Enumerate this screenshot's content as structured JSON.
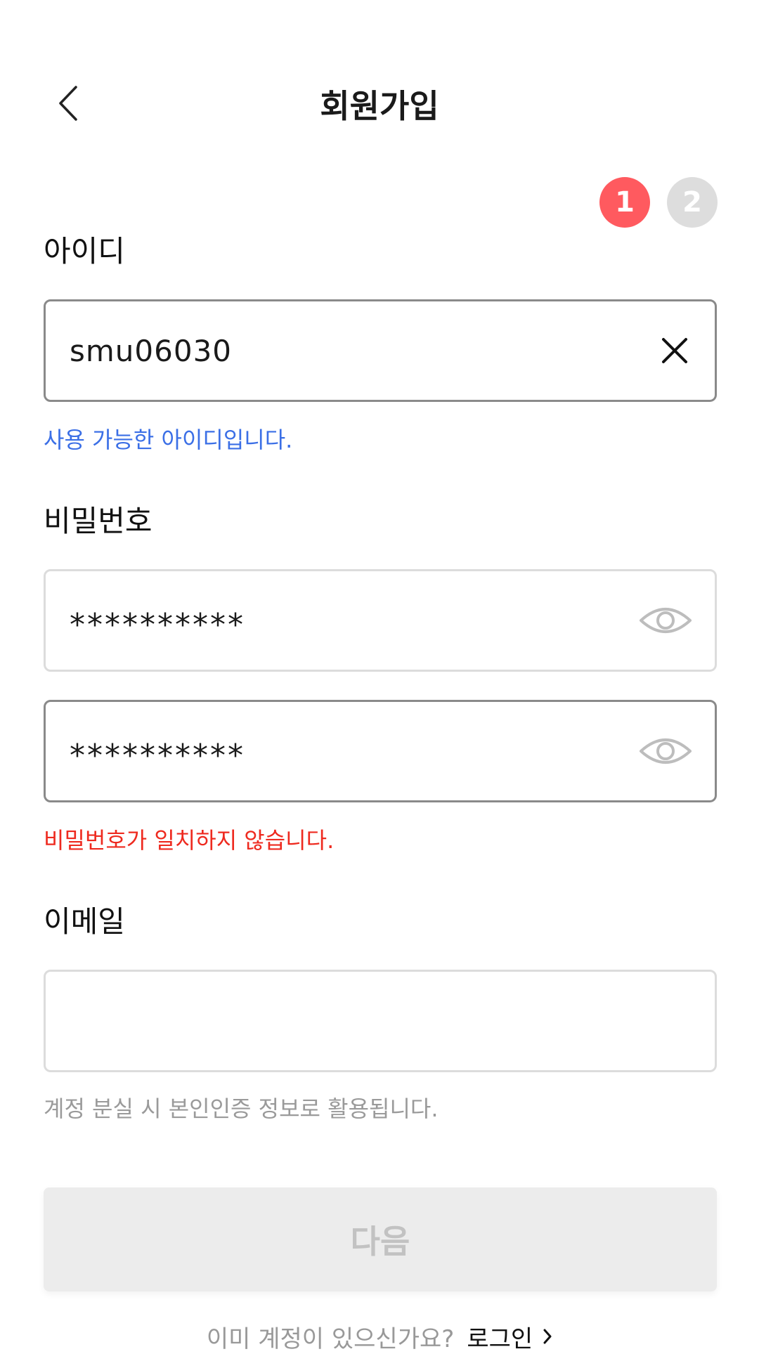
{
  "header": {
    "title": "회원가입"
  },
  "steps": [
    {
      "label": "1",
      "active": true,
      "color": "#ff5a5f"
    },
    {
      "label": "2",
      "active": false,
      "color": "#dddddd"
    }
  ],
  "id_field": {
    "label": "아이디",
    "value": "smu06030",
    "message": "사용 가능한 아이디입니다."
  },
  "password_field": {
    "label": "비밀번호",
    "value": "**********",
    "confirm_value": "**********",
    "message": "비밀번호가 일치하지 않습니다."
  },
  "email_field": {
    "label": "이메일",
    "value": "",
    "message": "계정 분실 시 본인인증 정보로 활용됩니다."
  },
  "next_button": {
    "label": "다음",
    "enabled": false
  },
  "footer": {
    "question": "이미 계정이 있으신가요?",
    "login_label": "로그인"
  },
  "colors": {
    "accent": "#ff5a5f",
    "success": "#3b6fe6",
    "error": "#ee2a1f"
  }
}
